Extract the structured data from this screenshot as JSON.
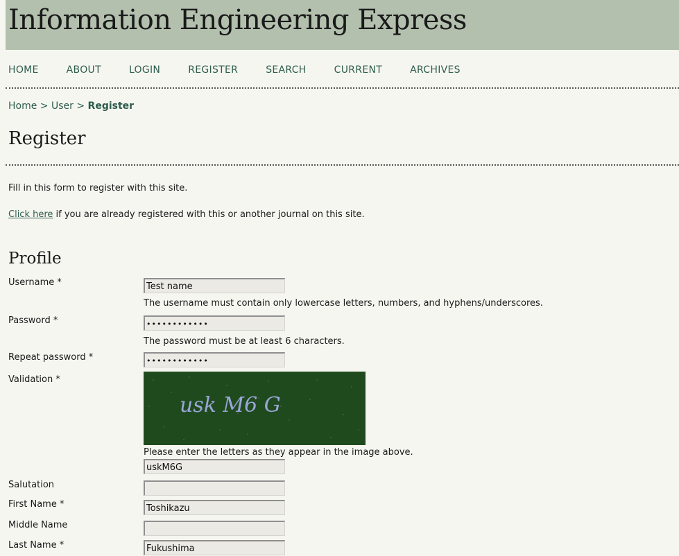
{
  "site": {
    "title": "Information Engineering Express"
  },
  "nav": [
    {
      "label": "HOME"
    },
    {
      "label": "ABOUT"
    },
    {
      "label": "LOGIN"
    },
    {
      "label": "REGISTER"
    },
    {
      "label": "SEARCH"
    },
    {
      "label": "CURRENT"
    },
    {
      "label": "ARCHIVES"
    }
  ],
  "breadcrumb": {
    "home": "Home",
    "sep": ">",
    "user": "User",
    "current": "Register"
  },
  "page": {
    "title": "Register",
    "intro": "Fill in this form to register with this site.",
    "already_link": "Click here",
    "already_text": " if you are already registered with this or another journal on this site."
  },
  "profile": {
    "title": "Profile",
    "username": {
      "label": "Username *",
      "value": "Test name",
      "hint": "The username must contain only lowercase letters, numbers, and hyphens/underscores."
    },
    "password": {
      "label": "Password *",
      "value": "••••••••••••",
      "hint": "The password must be at least 6 characters."
    },
    "repeat_password": {
      "label": "Repeat password *",
      "value": "••••••••••••"
    },
    "validation": {
      "label": "Validation *",
      "captcha_text": "usk M6 G",
      "hint": "Please enter the letters as they appear in the image above.",
      "value": "uskM6G"
    },
    "salutation": {
      "label": "Salutation",
      "value": ""
    },
    "first_name": {
      "label": "First Name *",
      "value": "Toshikazu"
    },
    "middle_name": {
      "label": "Middle Name",
      "value": ""
    },
    "last_name": {
      "label": "Last Name *",
      "value": "Fukushima"
    }
  },
  "colors": {
    "header_bg": "#b3c0ae",
    "link": "#2e5d4e",
    "captcha_bg": "#1f4a1e",
    "captcha_text": "#9aa6d8"
  }
}
